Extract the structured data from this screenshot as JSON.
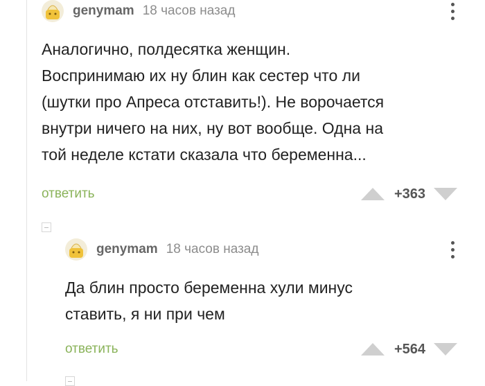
{
  "comments": [
    {
      "username": "genymam",
      "time": "18 часов назад",
      "text": "Аналогично, полдесятка женщин.\nВоспринимаю их ну блин как сестер что ли\n(шутки про Апреса отставить!). Не ворочается\nвнутри ничего на них, ну вот вообще. Одна на\nтой неделе кстати сказала что беременна...",
      "reply_label": "ответить",
      "rating": "+363"
    },
    {
      "username": "genymam",
      "time": "18 часов назад",
      "text": "Да блин просто беременна хули минус\nставить, я ни при чем",
      "reply_label": "ответить",
      "rating": "+564"
    }
  ],
  "icons": {
    "menu": "more-vertical-icon",
    "vote_up": "triangle-up-icon",
    "vote_down": "triangle-down-icon",
    "collapse": "collapse-minus-icon"
  },
  "colors": {
    "reply": "#8ab35a",
    "vote_arrow": "#cfcfcf",
    "thread_line": "#e3e3e3"
  }
}
